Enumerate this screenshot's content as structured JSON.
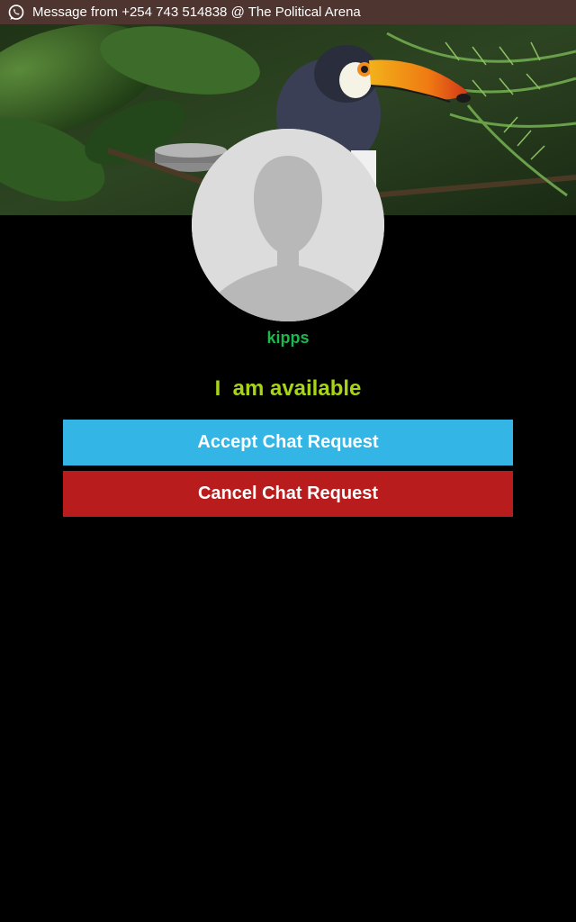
{
  "notification": {
    "icon": "whatsapp-icon",
    "text": "Message from +254 743 514838 @ The Political Arena",
    "background": "#4e3530"
  },
  "profile": {
    "cover_image": "toucan-in-jungle-photo",
    "avatar_icon": "default-person-silhouette-icon",
    "username": "kipps",
    "status": "I  am available"
  },
  "actions": {
    "accept_label": "Accept Chat Request",
    "cancel_label": "Cancel Chat Request",
    "accept_color": "#33b5e5",
    "cancel_color": "#b81c1c"
  },
  "colors": {
    "username": "#1ab84e",
    "status": "#a7d516",
    "background": "#000000"
  }
}
